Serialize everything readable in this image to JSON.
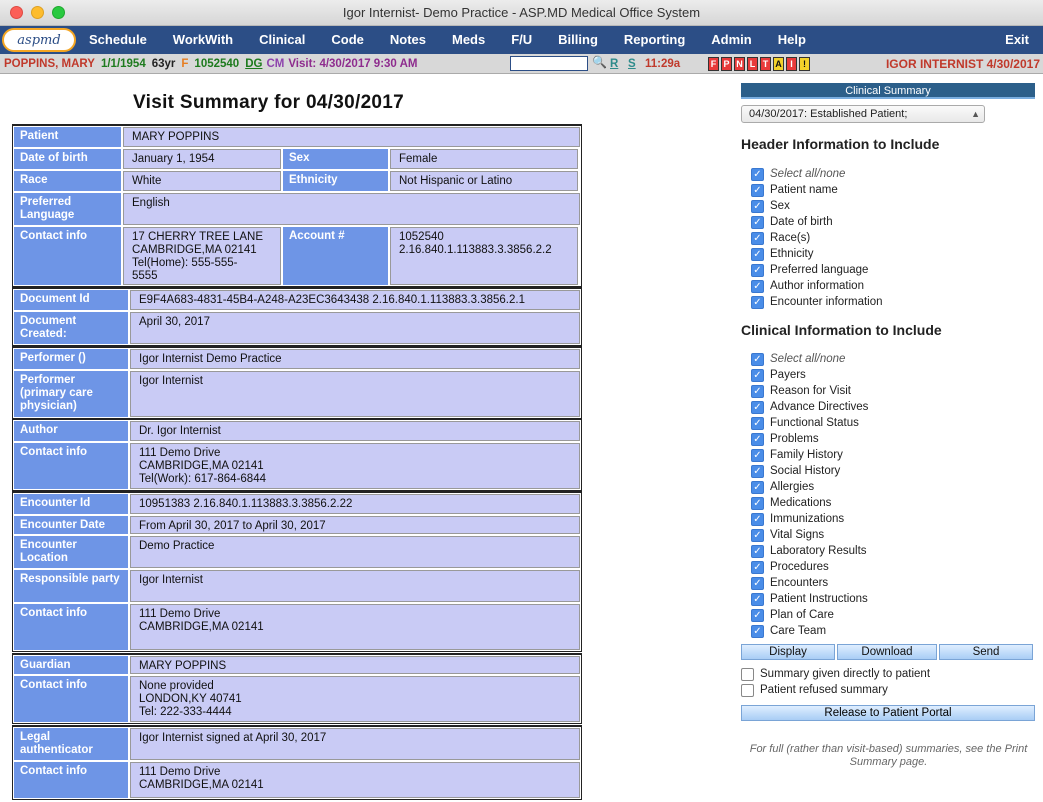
{
  "window": {
    "title": "Igor Internist- Demo Practice - ASP.MD Medical Office System"
  },
  "menu": {
    "logo": "aspmd",
    "items": [
      "Schedule",
      "WorkWith",
      "Clinical",
      "Code",
      "Notes",
      "Meds",
      "F/U",
      "Billing",
      "Reporting",
      "Admin",
      "Help"
    ],
    "exit": "Exit"
  },
  "patient_bar": {
    "name": "POPPINS, MARY",
    "dob": "1/1/1954",
    "age": "63yr",
    "sex": "F",
    "account": "1052540",
    "dg": "DG",
    "cm": "CM",
    "visit": "Visit: 4/30/2017 9:30 AM",
    "r": "R",
    "s": "S",
    "time": "11:29a",
    "flags": [
      "F",
      "P",
      "N",
      "L",
      "T",
      "A",
      "I",
      "!"
    ],
    "provider": "IGOR INTERNIST 4/30/2017"
  },
  "summary": {
    "title": "Visit Summary for 04/30/2017",
    "patient": {
      "patient_label": "Patient",
      "patient": "MARY POPPINS",
      "dob_label": "Date of birth",
      "dob": "January 1, 1954",
      "sex_label": "Sex",
      "sex": "Female",
      "race_label": "Race",
      "race": "White",
      "eth_label": "Ethnicity",
      "eth": "Not Hispanic or Latino",
      "lang_label": "Preferred Language",
      "lang": "English",
      "contact_label": "Contact info",
      "contact1": "17 CHERRY TREE LANE",
      "contact2": "CAMBRIDGE,MA 02141",
      "contact3": "Tel(Home): 555-555-",
      "contact4": "5555",
      "acct_label": "Account #",
      "acct1": "1052540",
      "acct2": "2.16.840.1.113883.3.3856.2.2"
    },
    "document": {
      "id_label": "Document Id",
      "id": "E9F4A683-4831-45B4-A248-A23EC3643438 2.16.840.1.113883.3.3856.2.1",
      "created_label": "Document Created:",
      "created": "April 30, 2017"
    },
    "performer": {
      "p_label": "Performer ()",
      "p": "Igor Internist Demo Practice",
      "pcp_label": "Performer (primary care physician)",
      "pcp": "Igor Internist"
    },
    "author": {
      "a_label": "Author",
      "a": "Dr. Igor Internist",
      "c_label": "Contact info",
      "c1": "111 Demo Drive",
      "c2": "CAMBRIDGE,MA 02141",
      "c3": "Tel(Work): 617-864-6844"
    },
    "encounter": {
      "id_label": "Encounter Id",
      "id": "10951383 2.16.840.1.113883.3.3856.2.22",
      "date_label": "Encounter Date",
      "date": "From April 30, 2017 to April 30, 2017",
      "loc_label": "Encounter Location",
      "loc": "Demo Practice",
      "resp_label": "Responsible party",
      "resp": "Igor Internist",
      "c_label": "Contact info",
      "c1": "111 Demo Drive",
      "c2": "CAMBRIDGE,MA 02141"
    },
    "guardian": {
      "g_label": "Guardian",
      "g": "MARY POPPINS",
      "c_label": "Contact info",
      "c1": "None provided",
      "c2": "LONDON,KY 40741",
      "c3": "Tel: 222-333-4444"
    },
    "legal": {
      "l_label": "Legal authenticator",
      "l": "Igor Internist signed at April 30, 2017",
      "c_label": "Contact info",
      "c1": "111 Demo Drive",
      "c2": "CAMBRIDGE,MA 02141"
    }
  },
  "panel": {
    "header": "Clinical Summary",
    "select_value": "04/30/2017: Established Patient;",
    "header_title": "Header Information to Include",
    "header_items": [
      "Select all/none",
      "Patient name",
      "Sex",
      "Date of birth",
      "Race(s)",
      "Ethnicity",
      "Preferred language",
      "Author information",
      "Encounter information"
    ],
    "clinical_title": "Clinical Information to Include",
    "clinical_items": [
      "Select all/none",
      "Payers",
      "Reason for Visit",
      "Advance Directives",
      "Functional Status",
      "Problems",
      "Family History",
      "Social History",
      "Allergies",
      "Medications",
      "Immunizations",
      "Vital Signs",
      "Laboratory Results",
      "Procedures",
      "Encounters",
      "Patient Instructions",
      "Plan of Care",
      "Care Team"
    ],
    "display": "Display",
    "download": "Download",
    "send": "Send",
    "given": "Summary given directly to patient",
    "refused": "Patient refused summary",
    "release": "Release to Patient Portal",
    "note": "For full (rather than visit-based) summaries, see the Print Summary page."
  }
}
